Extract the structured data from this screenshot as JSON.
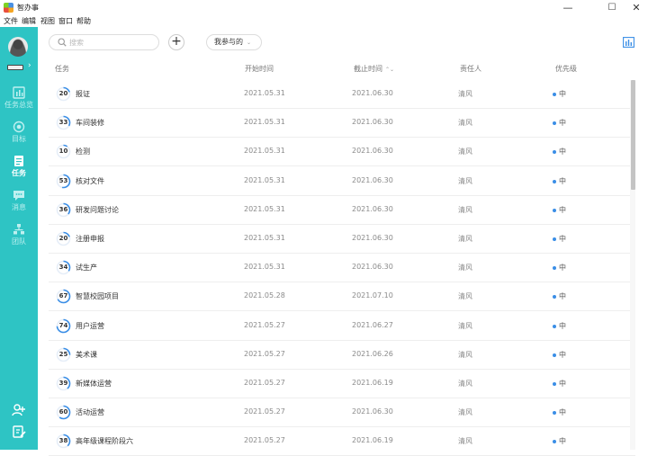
{
  "window": {
    "title": "智办事",
    "controls": {
      "minimize": "—",
      "maximize": "☐",
      "close": "✕"
    }
  },
  "menu": [
    "文件",
    "编辑",
    "视图",
    "窗口",
    "帮助"
  ],
  "sidebar": {
    "items": [
      {
        "label": "任务总览",
        "icon": "overview-icon",
        "active": false
      },
      {
        "label": "目标",
        "icon": "target-icon",
        "active": false
      },
      {
        "label": "任务",
        "icon": "task-icon",
        "active": true
      },
      {
        "label": "消息",
        "icon": "message-icon",
        "active": false
      },
      {
        "label": "团队",
        "icon": "team-icon",
        "active": false
      }
    ],
    "bottom_icons": [
      "add-member-icon",
      "edit-note-icon"
    ],
    "accent": "#2ec4c4"
  },
  "toolbar": {
    "search_placeholder": "搜索",
    "add_label": "+",
    "filter_label": "我参与的",
    "filter_chevron": "⌄"
  },
  "table": {
    "headers": {
      "task": "任务",
      "start": "开始时间",
      "end": "截止时间",
      "end_sort": "⌃⌄",
      "owner": "责任人",
      "priority": "优先级"
    },
    "rows": [
      {
        "progress": 20,
        "name": "报证",
        "start": "2021.05.31",
        "end": "2021.06.30",
        "owner": "清风",
        "priority": "中"
      },
      {
        "progress": 33,
        "name": "车间装修",
        "start": "2021.05.31",
        "end": "2021.06.30",
        "owner": "清风",
        "priority": "中"
      },
      {
        "progress": 10,
        "name": "检测",
        "start": "2021.05.31",
        "end": "2021.06.30",
        "owner": "清风",
        "priority": "中"
      },
      {
        "progress": 53,
        "name": "核对文件",
        "start": "2021.05.31",
        "end": "2021.06.30",
        "owner": "清风",
        "priority": "中"
      },
      {
        "progress": 36,
        "name": "研发问题讨论",
        "start": "2021.05.31",
        "end": "2021.06.30",
        "owner": "清风",
        "priority": "中"
      },
      {
        "progress": 20,
        "name": "注册申报",
        "start": "2021.05.31",
        "end": "2021.06.30",
        "owner": "清风",
        "priority": "中"
      },
      {
        "progress": 34,
        "name": "试生产",
        "start": "2021.05.31",
        "end": "2021.06.30",
        "owner": "清风",
        "priority": "中"
      },
      {
        "progress": 67,
        "name": "智慧校园项目",
        "start": "2021.05.28",
        "end": "2021.07.10",
        "owner": "清风",
        "priority": "中"
      },
      {
        "progress": 74,
        "name": "用户运营",
        "start": "2021.05.27",
        "end": "2021.06.27",
        "owner": "清风",
        "priority": "中"
      },
      {
        "progress": 25,
        "name": "美术课",
        "start": "2021.05.27",
        "end": "2021.06.26",
        "owner": "清风",
        "priority": "中"
      },
      {
        "progress": 39,
        "name": "新媒体运营",
        "start": "2021.05.27",
        "end": "2021.06.19",
        "owner": "清风",
        "priority": "中"
      },
      {
        "progress": 60,
        "name": "活动运营",
        "start": "2021.05.27",
        "end": "2021.06.30",
        "owner": "清风",
        "priority": "中"
      },
      {
        "progress": 38,
        "name": "高年级课程阶段六",
        "start": "2021.05.27",
        "end": "2021.06.19",
        "owner": "清风",
        "priority": "中"
      }
    ]
  },
  "colors": {
    "ring": "#3a8ee6",
    "ring_track": "#e6eef8",
    "priority_dot": "#3a8ee6"
  }
}
